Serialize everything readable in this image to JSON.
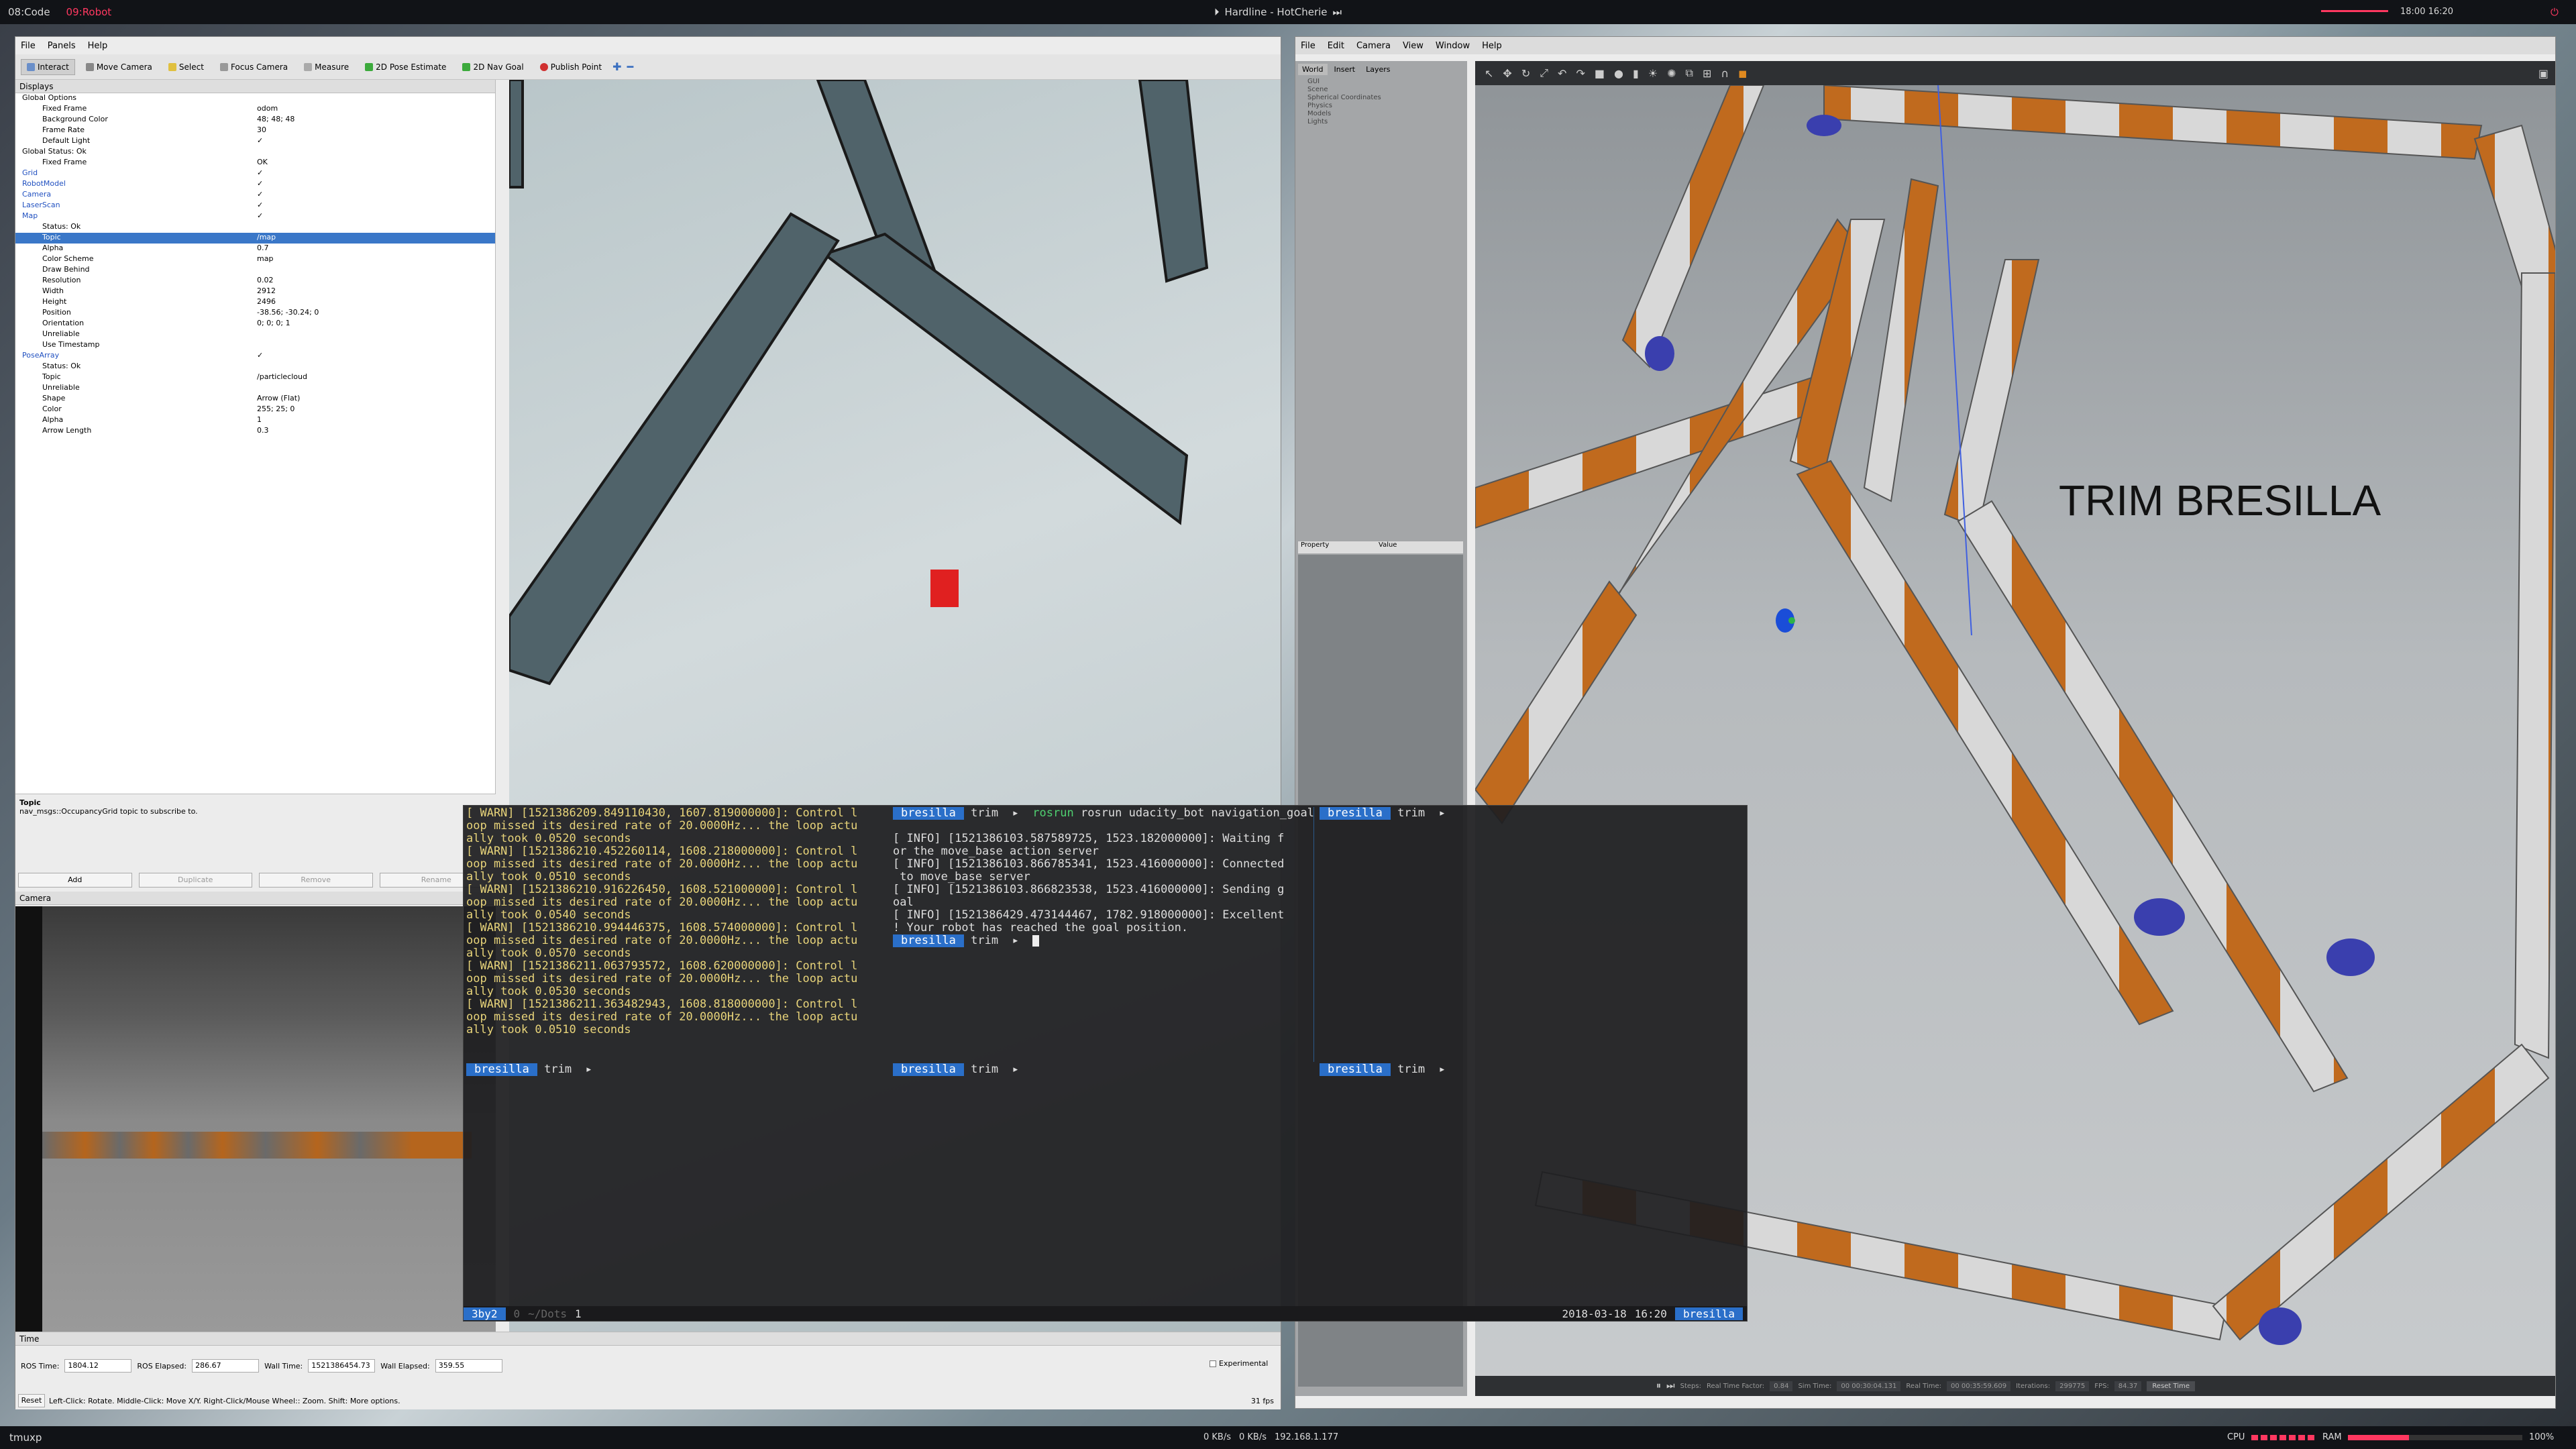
{
  "topbar": {
    "workspaces": [
      "08:Code",
      "09:Robot"
    ],
    "active_workspace": "09:Robot",
    "now_playing": "Hardline - HotCherie",
    "clock": "18:00 16:20"
  },
  "rviz": {
    "menu": [
      "File",
      "Panels",
      "Help"
    ],
    "toolbar": [
      "Interact",
      "Move Camera",
      "Select",
      "Focus Camera",
      "Measure",
      "2D Pose Estimate",
      "2D Nav Goal",
      "Publish Point"
    ],
    "displays_title": "Displays",
    "tree": [
      {
        "k": "Global Options",
        "v": "",
        "indent": 0,
        "bold": false
      },
      {
        "k": "Fixed Frame",
        "v": "odom",
        "indent": 1
      },
      {
        "k": "Background Color",
        "v": "48; 48; 48",
        "indent": 1
      },
      {
        "k": "Frame Rate",
        "v": "30",
        "indent": 1
      },
      {
        "k": "Default Light",
        "v": "✓",
        "indent": 1
      },
      {
        "k": "Global Status: Ok",
        "v": "",
        "indent": 0
      },
      {
        "k": "Fixed Frame",
        "v": "OK",
        "indent": 1
      },
      {
        "k": "Grid",
        "v": "✓",
        "indent": 0,
        "blue": true
      },
      {
        "k": "RobotModel",
        "v": "✓",
        "indent": 0,
        "blue": true
      },
      {
        "k": "Camera",
        "v": "✓",
        "indent": 0,
        "blue": true
      },
      {
        "k": "LaserScan",
        "v": "✓",
        "indent": 0,
        "blue": true
      },
      {
        "k": "Map",
        "v": "✓",
        "indent": 0,
        "blue": true
      },
      {
        "k": "Status: Ok",
        "v": "",
        "indent": 1
      },
      {
        "k": "Topic",
        "v": "/map",
        "indent": 1,
        "sel": true
      },
      {
        "k": "Alpha",
        "v": "0.7",
        "indent": 1
      },
      {
        "k": "Color Scheme",
        "v": "map",
        "indent": 1
      },
      {
        "k": "Draw Behind",
        "v": "",
        "indent": 1
      },
      {
        "k": "Resolution",
        "v": "0.02",
        "indent": 1
      },
      {
        "k": "Width",
        "v": "2912",
        "indent": 1
      },
      {
        "k": "Height",
        "v": "2496",
        "indent": 1
      },
      {
        "k": "Position",
        "v": "-38.56; -30.24; 0",
        "indent": 1
      },
      {
        "k": "Orientation",
        "v": "0; 0; 0; 1",
        "indent": 1
      },
      {
        "k": "Unreliable",
        "v": "",
        "indent": 1
      },
      {
        "k": "Use Timestamp",
        "v": "",
        "indent": 1
      },
      {
        "k": "PoseArray",
        "v": "✓",
        "indent": 0,
        "blue": true
      },
      {
        "k": "Status: Ok",
        "v": "",
        "indent": 1
      },
      {
        "k": "Topic",
        "v": "/particlecloud",
        "indent": 1
      },
      {
        "k": "Unreliable",
        "v": "",
        "indent": 1
      },
      {
        "k": "Shape",
        "v": "Arrow (Flat)",
        "indent": 1
      },
      {
        "k": "Color",
        "v": "255; 25; 0",
        "indent": 1
      },
      {
        "k": "Alpha",
        "v": "1",
        "indent": 1
      },
      {
        "k": "Arrow Length",
        "v": "0.3",
        "indent": 1
      }
    ],
    "desc_title": "Topic",
    "desc_text": "nav_msgs::OccupancyGrid topic to subscribe to.",
    "buttons": [
      "Add",
      "Duplicate",
      "Remove",
      "Rename"
    ],
    "camera_title": "Camera",
    "time_title": "Time",
    "time_fields": [
      {
        "label": "ROS Time:",
        "value": "1804.12"
      },
      {
        "label": "ROS Elapsed:",
        "value": "286.67"
      },
      {
        "label": "Wall Time:",
        "value": "1521386454.73"
      },
      {
        "label": "Wall Elapsed:",
        "value": "359.55"
      }
    ],
    "experimental": "Experimental",
    "reset": "Reset",
    "status_hint": "Left-Click: Rotate. Middle-Click: Move X/Y. Right-Click/Mouse Wheel:: Zoom. Shift: More options.",
    "fps": "31 fps"
  },
  "gazebo": {
    "menu": [
      "File",
      "Edit",
      "Camera",
      "View",
      "Window",
      "Help"
    ],
    "tabs": [
      "World",
      "Insert",
      "Layers"
    ],
    "world_tree": [
      "GUI",
      "Scene",
      "Spherical Coordinates",
      "Physics",
      "Models",
      "Lights"
    ],
    "prop_headers": [
      "Property",
      "Value"
    ],
    "overlay_text": "TRIM BRESILLA",
    "bottom": {
      "steps": "Steps:",
      "rtf_label": "Real Time Factor:",
      "rtf": "0.84",
      "sim_label": "Sim Time:",
      "sim": "00 00:30:04.131",
      "real_label": "Real Time:",
      "real": "00 00:35:59.609",
      "iter_label": "Iterations:",
      "iter": "299775",
      "fps_label": "FPS:",
      "fps": "84.37",
      "reset": "Reset Time"
    }
  },
  "terminal": {
    "left_lines": [
      "[ WARN] [1521386209.849110430, 1607.819000000]: Control l",
      "oop missed its desired rate of 20.0000Hz... the loop actu",
      "ally took 0.0520 seconds",
      "[ WARN] [1521386210.452260114, 1608.218000000]: Control l",
      "oop missed its desired rate of 20.0000Hz... the loop actu",
      "ally took 0.0510 seconds",
      "[ WARN] [1521386210.916226450, 1608.521000000]: Control l",
      "oop missed its desired rate of 20.0000Hz... the loop actu",
      "ally took 0.0540 seconds",
      "[ WARN] [1521386210.994446375, 1608.574000000]: Control l",
      "oop missed its desired rate of 20.0000Hz... the loop actu",
      "ally took 0.0570 seconds",
      "[ WARN] [1521386211.063793572, 1608.620000000]: Control l",
      "oop missed its desired rate of 20.0000Hz... the loop actu",
      "ally took 0.0530 seconds",
      "[ WARN] [1521386211.363482943, 1608.818000000]: Control l",
      "oop missed its desired rate of 20.0000Hz... the loop actu",
      "ally took 0.0510 seconds"
    ],
    "mid_cmd": "rosrun udacity_bot navigation_goal",
    "mid_lines": [
      "[ INFO] [1521386103.587589725, 1523.182000000]: Waiting f",
      "or the move_base action server",
      "[ INFO] [1521386103.866785341, 1523.416000000]: Connected",
      " to move_base server",
      "[ INFO] [1521386103.866823538, 1523.416000000]: Sending g",
      "oal",
      "[ INFO] [1521386429.473144467, 1782.918000000]: Excellent",
      "! Your robot has reached the goal position."
    ],
    "host": "bresilla",
    "dir": "trim",
    "session": "3by2",
    "tabs": [
      "0",
      "~/Dots",
      "1"
    ],
    "date": "2018-03-18",
    "time": "16:20"
  },
  "bottombar": {
    "app": "tmuxp",
    "net_up": "0 KB/s",
    "net_down": "0 KB/s",
    "ip": "192.168.1.177",
    "cpu_label": "CPU",
    "ram_label": "RAM",
    "battery": "100%"
  }
}
